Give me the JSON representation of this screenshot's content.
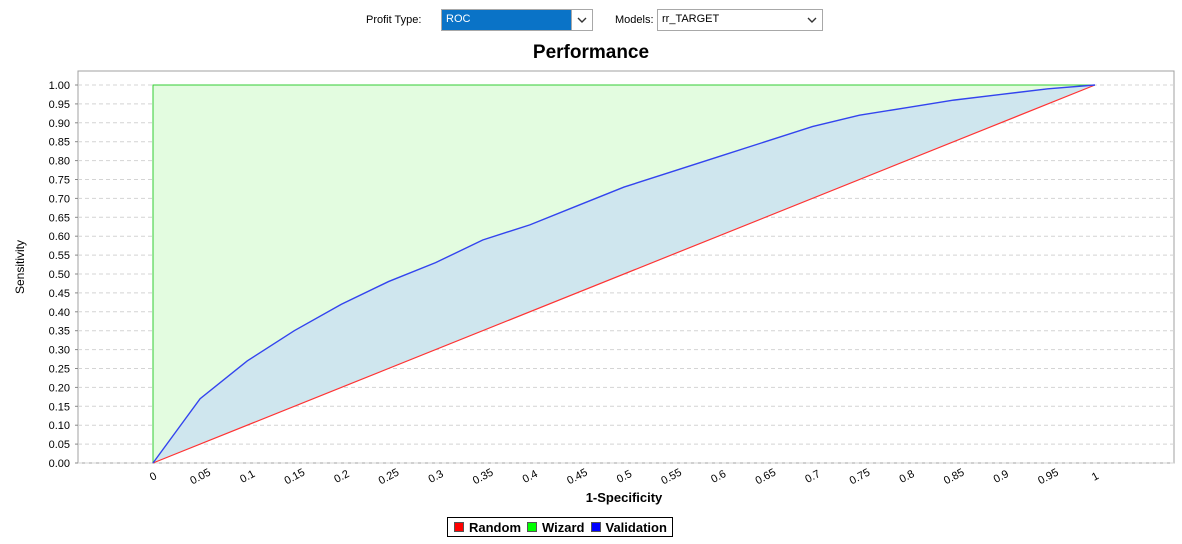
{
  "toolbar": {
    "profit_type_label": "Profit Type:",
    "profit_type_value": "ROC",
    "models_label": "Models:",
    "models_value": "rr_TARGET"
  },
  "chart_data": {
    "type": "area",
    "title": "Performance",
    "xlabel": "1-Specificity",
    "ylabel": "Sensitivity",
    "xlim": [
      0,
      1
    ],
    "ylim": [
      0,
      1
    ],
    "x_ticks": [
      "0",
      "0.05",
      "0.1",
      "0.15",
      "0.2",
      "0.25",
      "0.3",
      "0.35",
      "0.4",
      "0.45",
      "0.5",
      "0.55",
      "0.6",
      "0.65",
      "0.7",
      "0.75",
      "0.8",
      "0.85",
      "0.9",
      "0.95",
      "1"
    ],
    "y_ticks": [
      "0.00",
      "0.05",
      "0.10",
      "0.15",
      "0.20",
      "0.25",
      "0.30",
      "0.35",
      "0.40",
      "0.45",
      "0.50",
      "0.55",
      "0.60",
      "0.65",
      "0.70",
      "0.75",
      "0.80",
      "0.85",
      "0.90",
      "0.95",
      "1.00"
    ],
    "grid": true,
    "legend_position": "bottom-center",
    "series": [
      {
        "name": "Random",
        "color": "#ff0000",
        "x": [
          0,
          1
        ],
        "y": [
          0,
          1
        ]
      },
      {
        "name": "Wizard",
        "color": "#00cc00",
        "x": [
          0,
          0,
          1
        ],
        "y": [
          0,
          1,
          1
        ]
      },
      {
        "name": "Validation",
        "color": "#0000ff",
        "x": [
          0,
          0.05,
          0.1,
          0.15,
          0.2,
          0.25,
          0.3,
          0.35,
          0.4,
          0.45,
          0.5,
          0.55,
          0.6,
          0.65,
          0.7,
          0.75,
          0.8,
          0.85,
          0.9,
          0.95,
          1
        ],
        "y": [
          0,
          0.17,
          0.27,
          0.35,
          0.42,
          0.48,
          0.53,
          0.59,
          0.63,
          0.68,
          0.73,
          0.77,
          0.81,
          0.85,
          0.89,
          0.92,
          0.94,
          0.96,
          0.975,
          0.99,
          1.0
        ]
      }
    ]
  }
}
